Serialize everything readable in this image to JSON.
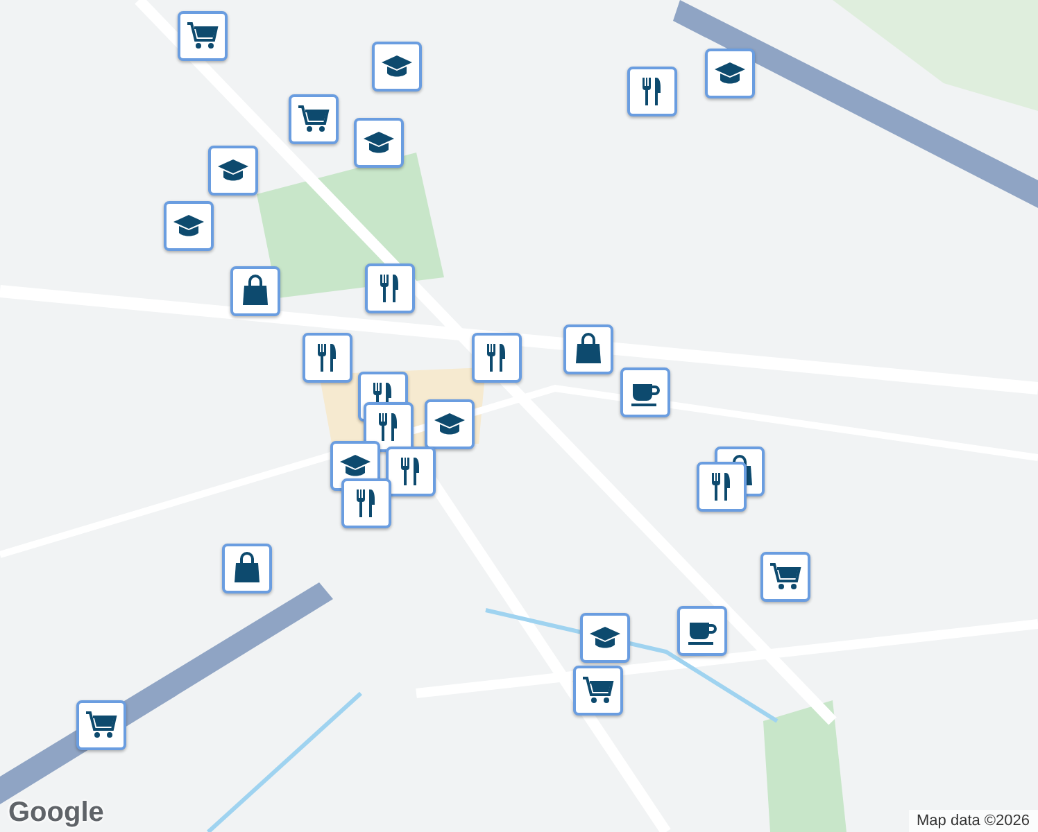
{
  "markers": [
    {
      "kind": "cart"
    },
    {
      "kind": "school"
    },
    {
      "kind": "cart"
    },
    {
      "kind": "school"
    },
    {
      "kind": "restaurant"
    },
    {
      "kind": "school"
    },
    {
      "kind": "school"
    },
    {
      "kind": "school"
    },
    {
      "kind": "bag"
    },
    {
      "kind": "restaurant"
    },
    {
      "kind": "restaurant"
    },
    {
      "kind": "restaurant"
    },
    {
      "kind": "bag"
    },
    {
      "kind": "coffee"
    },
    {
      "kind": "restaurant"
    },
    {
      "kind": "restaurant"
    },
    {
      "kind": "school"
    },
    {
      "kind": "school"
    },
    {
      "kind": "restaurant"
    },
    {
      "kind": "restaurant"
    },
    {
      "kind": "bag"
    },
    {
      "kind": "bag"
    },
    {
      "kind": "restaurant"
    },
    {
      "kind": "cart"
    },
    {
      "kind": "coffee"
    },
    {
      "kind": "school"
    },
    {
      "kind": "cart"
    },
    {
      "kind": "cart"
    }
  ],
  "logo": "Google",
  "attribution": "Map data ©2026"
}
